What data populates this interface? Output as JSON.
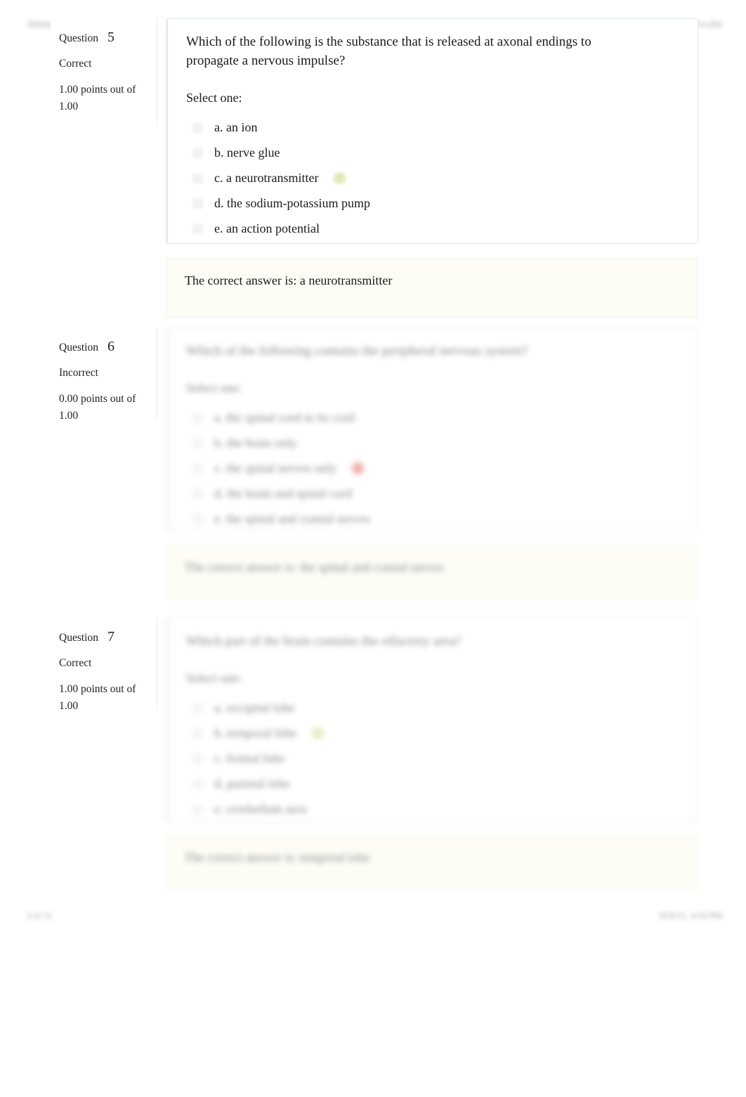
{
  "header": {
    "left_text": "Attempt review",
    "right_text": "https://www.example.com/mod/quiz/review.php"
  },
  "footer": {
    "left_text": "3 of 11",
    "right_text": "10/8/21, 4:54 PM"
  },
  "labels": {
    "question_word": "Question",
    "select_one": "Select one:"
  },
  "questions": [
    {
      "number": "5",
      "state": "Correct",
      "grade": "1.00 points out of 1.00",
      "text": "Which of the following is the substance that is released at axonal endings to propagate a nervous impulse?",
      "blurred": false,
      "answers": [
        {
          "label": "a. an ion",
          "mark": "none"
        },
        {
          "label": "b. nerve glue",
          "mark": "none"
        },
        {
          "label": "c. a neurotransmitter",
          "mark": "correct"
        },
        {
          "label": "d. the sodium-potassium pump",
          "mark": "none"
        },
        {
          "label": "e. an action potential",
          "mark": "none"
        }
      ],
      "feedback": "The correct answer is: a neurotransmitter"
    },
    {
      "number": "6",
      "state": "Incorrect",
      "grade": "0.00 points out of 1.00",
      "text": "Which of the following contains the peripheral nervous system?",
      "blurred": true,
      "answers": [
        {
          "label": "a. the spinal cord in its cord",
          "mark": "none"
        },
        {
          "label": "b. the brain only",
          "mark": "none"
        },
        {
          "label": "c. the spinal nerves only",
          "mark": "wrong"
        },
        {
          "label": "d. the brain and spinal cord",
          "mark": "none"
        },
        {
          "label": "e. the spinal and cranial nerves",
          "mark": "none"
        }
      ],
      "feedback": "The correct answer is: the spinal and cranial nerves"
    },
    {
      "number": "7",
      "state": "Correct",
      "grade": "1.00 points out of 1.00",
      "text": "Which part of the brain contains the olfactory area?",
      "blurred": true,
      "answers": [
        {
          "label": "a. occipital lobe",
          "mark": "none"
        },
        {
          "label": "b. temporal lobe",
          "mark": "correct"
        },
        {
          "label": "c. frontal lobe",
          "mark": "none"
        },
        {
          "label": "d. parietal lobe",
          "mark": "none"
        },
        {
          "label": "e. cerebellum area",
          "mark": "none"
        }
      ],
      "feedback": "The correct answer is: temporal lobe"
    }
  ]
}
